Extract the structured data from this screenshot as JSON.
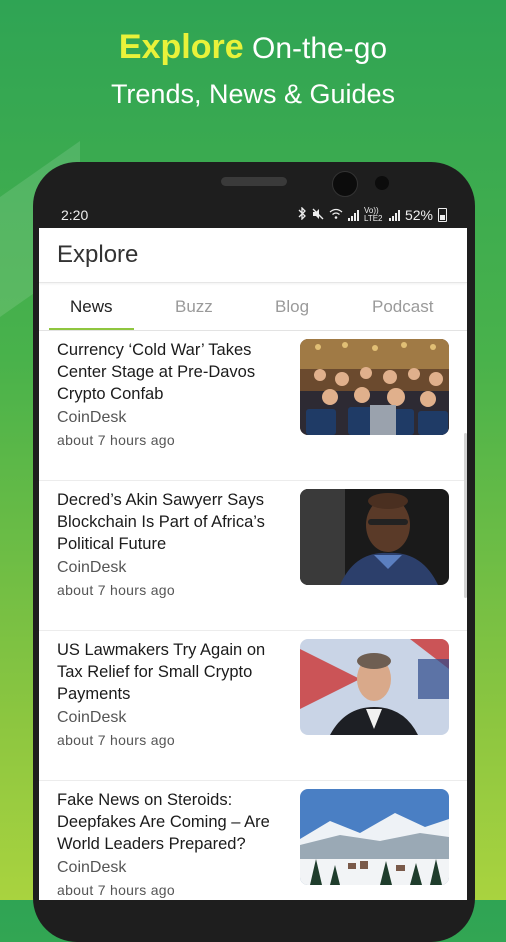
{
  "promo": {
    "highlight": "Explore",
    "line1_rest": "On-the-go",
    "line2": "Trends, News & Guides"
  },
  "status_bar": {
    "time": "2:20",
    "network_label": "Vo)) LTE2",
    "battery": "52%",
    "icons": [
      "bluetooth-icon",
      "mute-icon",
      "wifi-icon",
      "signal-icon",
      "battery-icon"
    ]
  },
  "app": {
    "title": "Explore",
    "tabs": [
      {
        "label": "News",
        "active": true
      },
      {
        "label": "Buzz",
        "active": false
      },
      {
        "label": "Blog",
        "active": false
      },
      {
        "label": "Podcast",
        "active": false
      }
    ],
    "accent_color": "#8fc63f"
  },
  "articles": [
    {
      "title": "Currency ‘Cold War’ Takes Center Stage at Pre-Davos Crypto Confab",
      "source": "CoinDesk",
      "time": "about 7 hours ago",
      "thumb": "conference-audience-image"
    },
    {
      "title": "Decred’s Akin Sawyerr Says Blockchain Is Part of Africa’s Political Future",
      "source": "CoinDesk",
      "time": "about 7 hours ago",
      "thumb": "speaker-portrait-image"
    },
    {
      "title": "US Lawmakers Try Again on Tax Relief for Small Crypto Payments",
      "source": "CoinDesk",
      "time": "about 7 hours ago",
      "thumb": "lawmaker-portrait-image"
    },
    {
      "title": "Fake News on Steroids: Deepfakes Are Coming – Are World Leaders Prepared?",
      "source": "CoinDesk",
      "time": "about 7 hours ago",
      "thumb": "snowy-mountain-town-image"
    }
  ]
}
